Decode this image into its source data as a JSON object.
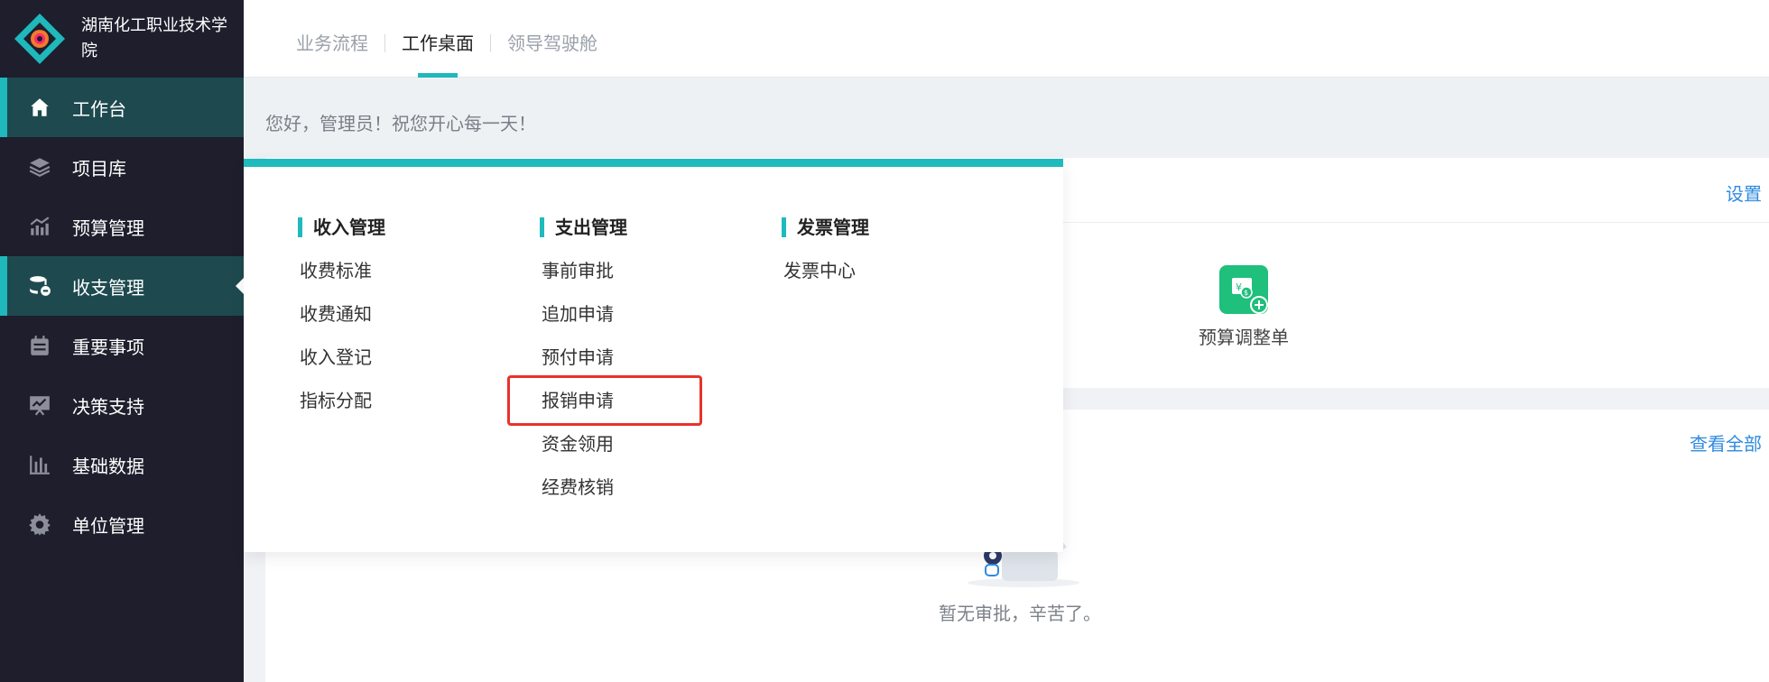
{
  "sidebar": {
    "org_name": "湖南化工职业技术学院",
    "items": [
      {
        "label": "工作台",
        "icon": "home-icon"
      },
      {
        "label": "项目库",
        "icon": "layers-icon"
      },
      {
        "label": "预算管理",
        "icon": "chart-trend-icon"
      },
      {
        "label": "收支管理",
        "icon": "database-icon"
      },
      {
        "label": "重要事项",
        "icon": "calendar-icon"
      },
      {
        "label": "决策支持",
        "icon": "presentation-icon"
      },
      {
        "label": "基础数据",
        "icon": "bar-chart-icon"
      },
      {
        "label": "单位管理",
        "icon": "gear-icon"
      }
    ]
  },
  "topbar": {
    "tabs": [
      {
        "label": "业务流程"
      },
      {
        "label": "工作桌面"
      },
      {
        "label": "领导驾驶舱"
      }
    ]
  },
  "greeting": "您好，管理员！祝您开心每一天！",
  "card1": {
    "settings_label": "设置",
    "tile_label": "预算调整单"
  },
  "card2": {
    "view_all_label": "查看全部",
    "empty_text": "暂无审批，辛苦了。"
  },
  "dropdown": {
    "columns": [
      {
        "title": "收入管理",
        "items": [
          "收费标准",
          "收费通知",
          "收入登记",
          "指标分配"
        ]
      },
      {
        "title": "支出管理",
        "items": [
          "事前审批",
          "追加申请",
          "预付申请",
          "报销申请",
          "资金领用",
          "经费核销"
        ]
      },
      {
        "title": "发票管理",
        "items": [
          "发票中心"
        ]
      }
    ]
  },
  "colors": {
    "accent": "#1fbabd",
    "sidebar_bg": "#1e1e2d",
    "sidebar_active": "#1e4a4f",
    "link": "#2f8be0",
    "highlight": "#e8322c"
  }
}
